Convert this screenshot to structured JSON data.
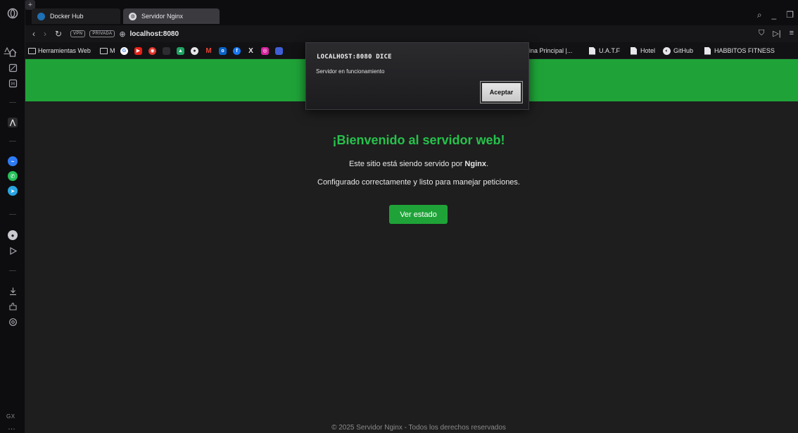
{
  "tabs": [
    {
      "label": "Docker Hub",
      "active": false
    },
    {
      "label": "Servidor Nginx",
      "active": true
    }
  ],
  "new_tab_label": "+",
  "address_bar": {
    "vpn_label": "VPN",
    "private_label": "PRIVADA",
    "url": "localhost:8080"
  },
  "bookmarks": {
    "herramientas": "Herramientas Web",
    "m_folder": "M",
    "pagina_principal": "gina Principal |...",
    "uatf": "U.A.T.F",
    "hotel": "Hotel",
    "github": "GitHub",
    "habbitos": "HABBITOS FITNESS"
  },
  "side_rail": {
    "gx_label": "GX"
  },
  "page": {
    "welcome_title": "¡Bienvenido al servidor web!",
    "served_prefix": "Este sitio está siendo servido por ",
    "served_bold": "Nginx",
    "served_suffix": ".",
    "config_line": "Configurado correctamente y listo para manejar peticiones.",
    "status_button": "Ver estado",
    "footer": "© 2025 Servidor Nginx - Todos los derechos reservados"
  },
  "alert": {
    "title": "LOCALHOST:8080 DICE",
    "message": "Servidor en funcionamiento",
    "accept_label": "Aceptar"
  },
  "colors": {
    "accent_green": "#1fa338",
    "title_green": "#27c24c",
    "page_bg": "#1e1e1e"
  }
}
